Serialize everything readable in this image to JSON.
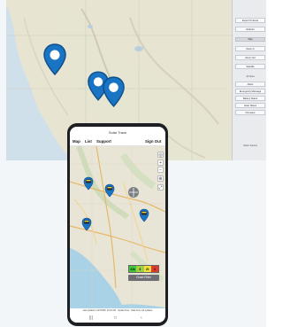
{
  "desktop": {
    "sidebar": {
      "buttons": [
        "Export To Excel",
        "Refresh",
        "Zoom In",
        "Zoom Out"
      ],
      "bars": [
        "Map",
        "Satellite",
        "All Sites",
        "Alerts"
      ],
      "items": [
        "Emergency Message",
        "Battery Status",
        "Solar Status",
        "Firmware"
      ],
      "bottom": "Select Device"
    }
  },
  "phone": {
    "app_title": "Solar Track",
    "nav": {
      "map": "Map",
      "list": "List",
      "support": "Support",
      "sign_out": "Sign Out"
    },
    "zoom_controls": [
      "+",
      "−",
      "◎",
      "⊕",
      "⤢"
    ],
    "legend": [
      {
        "label": "24h",
        "color": "#41c63b"
      },
      {
        "label": "6",
        "color": "#9fcf42"
      },
      {
        "label": "20",
        "color": "#f4e13c"
      },
      {
        "label": "3",
        "color": "#e4382d"
      }
    ],
    "chart_filter": "Chart Filter",
    "footer": "Last updated: 1/27/2025, 10:15 AM · Update Now · Data from cell updates",
    "system_nav": [
      "|||",
      "□",
      "‹"
    ]
  },
  "colors": {
    "pin_blue": "#1a74c4",
    "pin_dark": "#0e4f8c",
    "water": "#cfe0ea",
    "land": "#e8e4d2",
    "phone_body": "#1e1f22"
  }
}
